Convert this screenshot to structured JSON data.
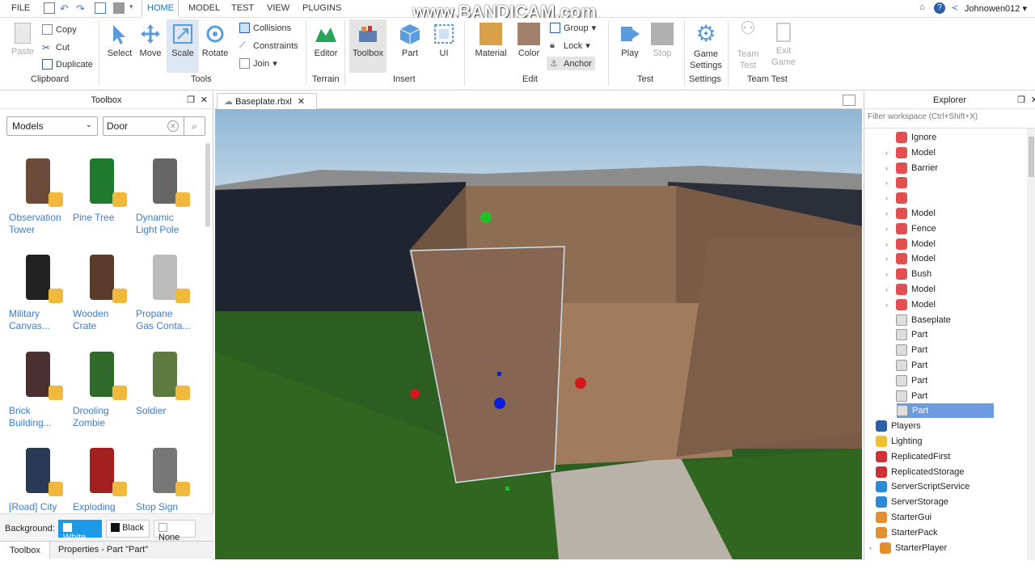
{
  "menu": {
    "file": "FILE",
    "tabs": [
      "HOME",
      "MODEL",
      "TEST",
      "VIEW",
      "PLUGINS"
    ]
  },
  "watermark": "www.BANDICAM.com",
  "user": "Johnowen012",
  "ribbon": {
    "clipboard": {
      "paste": "Paste",
      "copy": "Copy",
      "cut": "Cut",
      "duplicate": "Duplicate",
      "group": "Clipboard"
    },
    "tools": {
      "select": "Select",
      "move": "Move",
      "scale": "Scale",
      "rotate": "Rotate",
      "collisions": "Collisions",
      "constraints": "Constraints",
      "join": "Join",
      "group": "Tools"
    },
    "terrain": {
      "editor": "Editor",
      "group": "Terrain"
    },
    "insert": {
      "toolbox": "Toolbox",
      "part": "Part",
      "ui": "UI",
      "group": "Insert"
    },
    "edit": {
      "material": "Material",
      "color": "Color",
      "group_btn": "Group",
      "lock": "Lock",
      "anchor": "Anchor",
      "group": "Edit"
    },
    "test": {
      "play": "Play",
      "stop": "Stop",
      "group": "Test"
    },
    "settings": {
      "game_settings_1": "Game",
      "game_settings_2": "Settings",
      "group": "Settings"
    },
    "teamtest": {
      "team_1": "Team",
      "team_2": "Test",
      "exit_1": "Exit",
      "exit_2": "Game",
      "group": "Team Test"
    }
  },
  "toolbox": {
    "title": "Toolbox",
    "category": "Models",
    "search": "Door",
    "items": [
      {
        "l1": "Observation",
        "l2": "Tower"
      },
      {
        "l1": "Pine Tree",
        "l2": ""
      },
      {
        "l1": "Dynamic",
        "l2": "Light Pole"
      },
      {
        "l1": "Military",
        "l2": "Canvas..."
      },
      {
        "l1": "Wooden",
        "l2": "Crate"
      },
      {
        "l1": "Propane",
        "l2": "Gas Conta..."
      },
      {
        "l1": "Brick",
        "l2": "Building..."
      },
      {
        "l1": "Drooling",
        "l2": "Zombie"
      },
      {
        "l1": "Soldier",
        "l2": ""
      },
      {
        "l1": "[Road] City",
        "l2": ""
      },
      {
        "l1": "Exploding",
        "l2": ""
      },
      {
        "l1": "Stop Sign",
        "l2": ""
      }
    ],
    "bg_label": "Background:",
    "bg_white": "White",
    "bg_black": "Black",
    "bg_none": "None",
    "tab_toolbox": "Toolbox",
    "tab_properties": "Properties - Part \"Part\""
  },
  "document_tab": "Baseplate.rbxl",
  "explorer": {
    "title": "Explorer",
    "filter": "Filter workspace (Ctrl+Shift+X)",
    "rows": [
      {
        "label": "Ignore",
        "exp": false,
        "kind": "model"
      },
      {
        "label": "Model",
        "exp": true,
        "kind": "model"
      },
      {
        "label": "Barrier",
        "exp": true,
        "kind": "model"
      },
      {
        "label": "",
        "exp": true,
        "kind": "model"
      },
      {
        "label": "",
        "exp": true,
        "kind": "model"
      },
      {
        "label": "Model",
        "exp": true,
        "kind": "model"
      },
      {
        "label": "Fence",
        "exp": true,
        "kind": "model"
      },
      {
        "label": "Model",
        "exp": true,
        "kind": "model"
      },
      {
        "label": "Model",
        "exp": true,
        "kind": "model"
      },
      {
        "label": "Bush",
        "exp": true,
        "kind": "model"
      },
      {
        "label": "Model",
        "exp": true,
        "kind": "model"
      },
      {
        "label": "Model",
        "exp": true,
        "kind": "model"
      },
      {
        "label": "Baseplate",
        "exp": false,
        "kind": "part"
      },
      {
        "label": "Part",
        "exp": false,
        "kind": "part"
      },
      {
        "label": "Part",
        "exp": false,
        "kind": "part"
      },
      {
        "label": "Part",
        "exp": false,
        "kind": "part"
      },
      {
        "label": "Part",
        "exp": false,
        "kind": "part"
      },
      {
        "label": "Part",
        "exp": false,
        "kind": "part"
      },
      {
        "label": "Part",
        "exp": false,
        "kind": "part",
        "selected": true
      }
    ],
    "services": [
      "Players",
      "Lighting",
      "ReplicatedFirst",
      "ReplicatedStorage",
      "ServerScriptService",
      "ServerStorage",
      "StarterGui",
      "StarterPack",
      "StarterPlayer"
    ]
  },
  "colors": {
    "accent": "#1a73c8",
    "selected": "#6d9be0"
  }
}
